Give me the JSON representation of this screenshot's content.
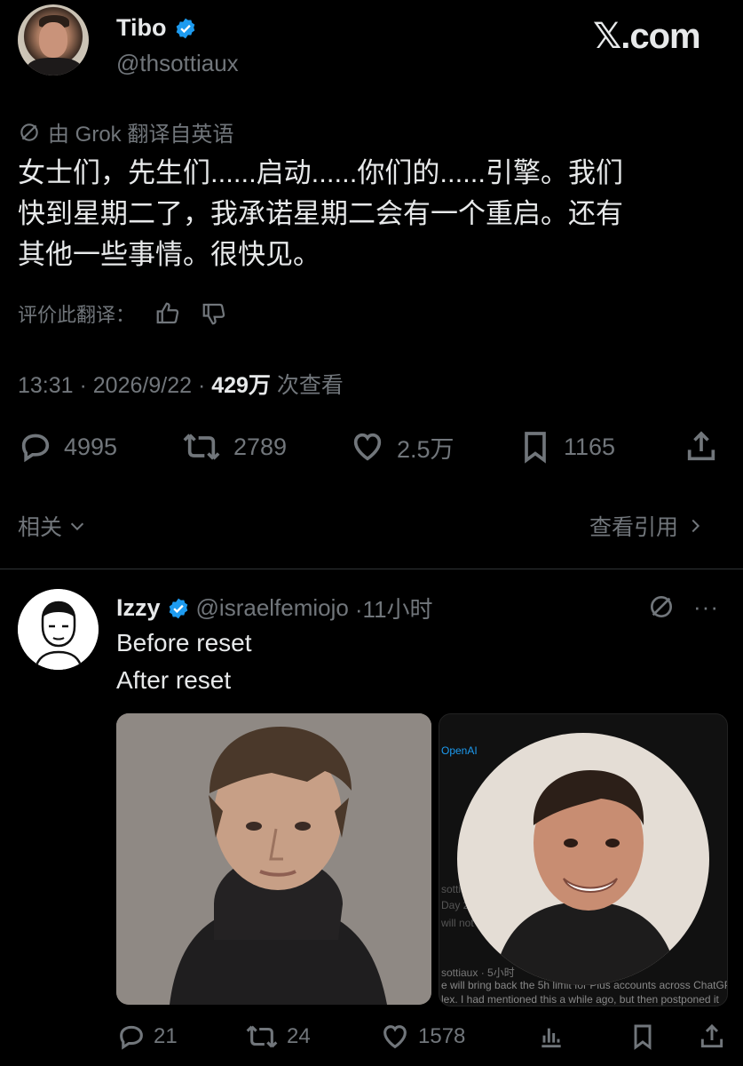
{
  "author": {
    "name": "Tibo",
    "handle": "@thsottiaux"
  },
  "brand": "𝕏.com",
  "translation_note": "由 Grok 翻译自英语",
  "tweet_text": [
    "女士们，先生们......启动......你们的......引擎。我们",
    "快到星期二了，我承诺星期二会有一个重启。还有",
    "其他一些事情。很快见。"
  ],
  "rate_label": "评价此翻译：",
  "meta": {
    "time_date": "13:31 · 2026/9/22 · ",
    "views_count": "429万",
    "views_label": " 次查看"
  },
  "actions": {
    "replies": "4995",
    "retweets": "2789",
    "likes": "2.5万",
    "bookmarks": "1165"
  },
  "related": {
    "left": "相关",
    "right": "查看引用"
  },
  "reply": {
    "name": "Izzy",
    "handle": "@israelfemiojo",
    "time": "·11小时",
    "lines": [
      "Before reset",
      "After reset"
    ],
    "screenshot_fragments": [
      "OpenAI",
      "sottiaux",
      "Day 2",
      "will not",
      "sottiaux · 5小时",
      "e will bring back the 5h limit for Plus accounts across ChatGP",
      "lex. I had mentioned this a while ago, but then postponed it"
    ],
    "actions": {
      "replies": "21",
      "retweets": "24",
      "likes": "1578"
    }
  },
  "colors": {
    "background": "#000000",
    "text": "#e7e9ea",
    "muted": "#71767b",
    "verified": "#1d9bf0",
    "divider": "#2f3336"
  }
}
